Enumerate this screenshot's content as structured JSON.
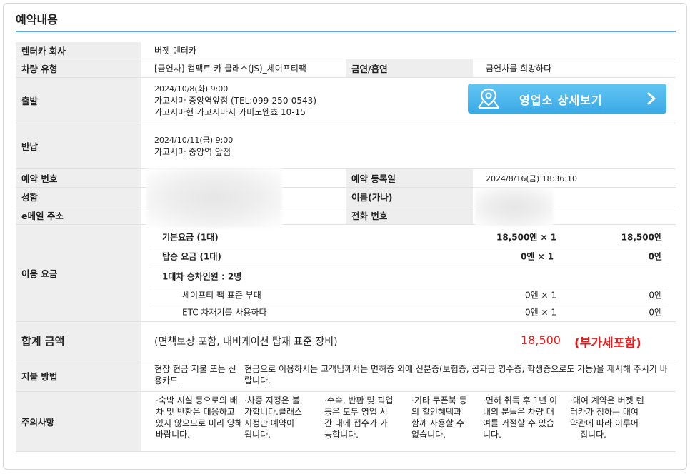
{
  "section_title": "예약내용",
  "rental_company": {
    "label": "렌터카 회사",
    "value": "버젯 렌터카"
  },
  "vehicle": {
    "label": "차량 유형",
    "value": "[금연차] 컴팩트 카 클래스(JS)_세이프티팩",
    "smoking_label": "금연/흡연",
    "smoking_value": "금연차를 희망하다"
  },
  "departure": {
    "label": "출발",
    "datetime": "2024/10/8(화) 9:00",
    "branch": "가고시마 중앙역앞점 (TEL:099-250-0543)",
    "address": "가고시마현 가고시마시 카미노엔쵸 10-15"
  },
  "branch_button": {
    "label": "영업소 상세보기",
    "icon": "map-pin-icon",
    "arrow": "chevron-right-icon",
    "color": "#4db8ee"
  },
  "return_info": {
    "label": "반납",
    "datetime": "2024/10/11(금) 9:00",
    "branch": "가고시마 중앙역 앞점"
  },
  "reservation": {
    "number_label": "예약 번호",
    "registered_label": "예약 등록일",
    "registered_value": "2024/8/16(금) 18:36:10",
    "name_label": "성함",
    "kana_label": "이름(가나)",
    "email_label": "e메일 주소",
    "phone_label": "전화 번호"
  },
  "fees": {
    "label": "이용 요금",
    "lines": [
      {
        "name": "기본요금 (1대)",
        "unit": "18,500엔 × 1",
        "amount": "18,500엔",
        "bold": true
      },
      {
        "name": "탑승 요금 (1대)",
        "unit": "0엔 × 1",
        "amount": "0엔",
        "bold": true
      },
      {
        "name": "1대차 승차인원 : 2명",
        "unit": "",
        "amount": "",
        "bold": true
      },
      {
        "name": "세이프티 팩 표준 부대",
        "unit": "0엔 × 1",
        "amount": "0엔",
        "bold": false
      },
      {
        "name": "ETC 차재기를 사용하다",
        "unit": "0엔 × 1",
        "amount": "0엔",
        "bold": false
      }
    ]
  },
  "total": {
    "label": "합계 금액",
    "note": "(면책보상 포함, 내비게이션 탑재 표준 장비)",
    "amount": "18,500",
    "tax_note": "(부가세포함)",
    "color": "#e81c1c"
  },
  "payment": {
    "label": "지불 방법",
    "method": "현장 현금 지불 또는 신용카드",
    "note": "현금으로 이용하시는 고객님께서는 면허증 외에 신분증(보험증, 공과금 영수증, 학생증으로도 가능)을 제시해 주시기 바랍니다."
  },
  "notices": {
    "label": "주의사항",
    "columns": [
      [
        "·숙박 시설 등으로의 배",
        "차 및 반환은 대응하고",
        "있지 않으므로 미리 양해",
        "바랍니다."
      ],
      [
        "·차종 지정은 불",
        "가합니다.클래스",
        "지정만 예약이",
        "됩니다."
      ],
      [
        "·수속, 반환 및 픽업",
        "등은 모두 영업 시",
        "간 내에 접수가 가",
        "능합니다."
      ],
      [
        "·기타 쿠폰북 등",
        "의 할인혜택과",
        "함께 사용할 수",
        "없습니다."
      ],
      [
        "·면허 취득 후 1년 이",
        "내의 분들은 차량 대",
        "여를 거절할 수 있습",
        "니다."
      ],
      [
        "·대여 계약은 버젯 렌",
        "터카가 정하는 대여",
        "약관에 따라 이루어",
        "집니다."
      ]
    ]
  }
}
